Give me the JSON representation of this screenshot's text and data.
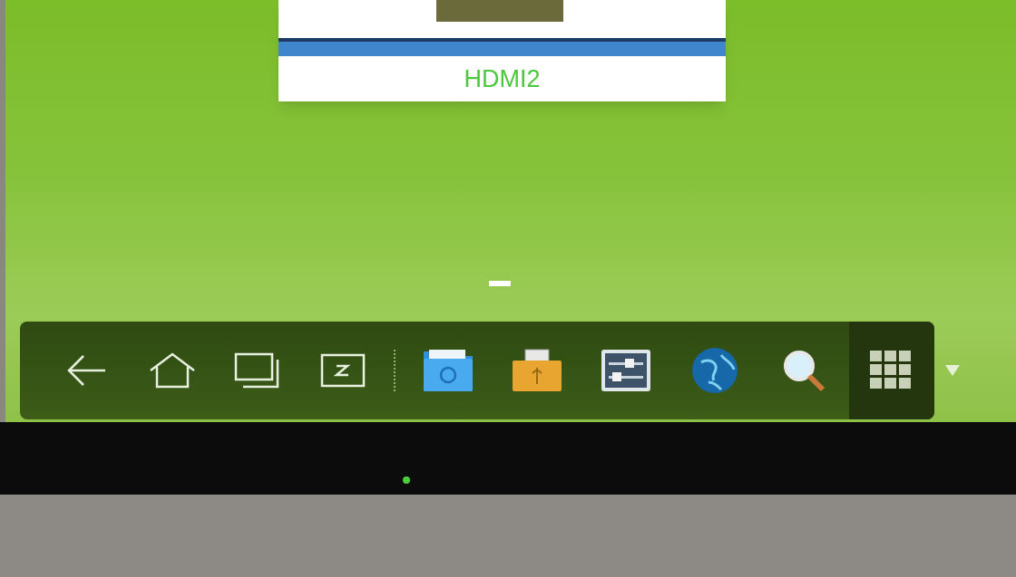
{
  "preview": {
    "label": "HDMI2"
  },
  "dock": {
    "nav": [
      {
        "kind": "back"
      },
      {
        "kind": "home"
      },
      {
        "kind": "recents"
      },
      {
        "kind": "whiteboard"
      }
    ],
    "apps": [
      {
        "kind": "folder"
      },
      {
        "kind": "usb"
      },
      {
        "kind": "settings"
      },
      {
        "kind": "globe"
      },
      {
        "kind": "search"
      }
    ],
    "launcher": {
      "kind": "grid"
    }
  }
}
